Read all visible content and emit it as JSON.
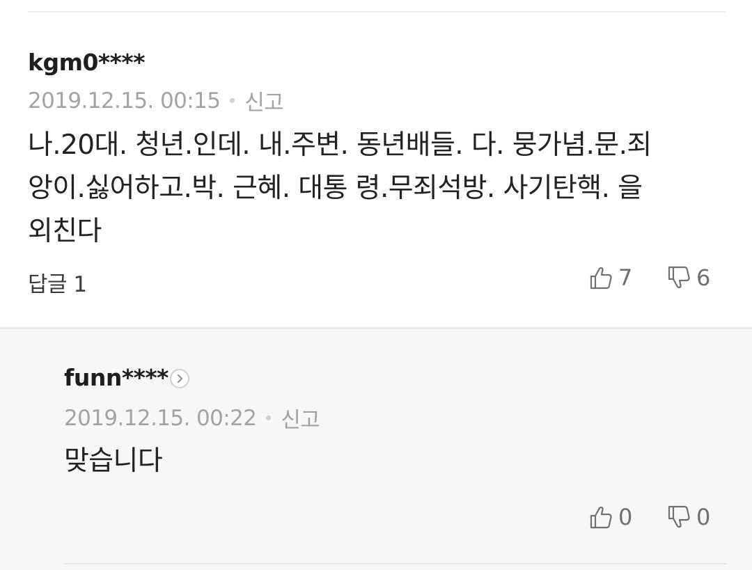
{
  "main_comment": {
    "username": "kgm0****",
    "timestamp": "2019.12.15. 00:15",
    "report_label": "신고",
    "lines": [
      "나.20대. 청년.인데. 내.주변. 동년배들. 다. 뭉가념.문.죄",
      "앙이.싫어하고.박. 근혜. 대통 령.무죄석방. 사기탄핵. 을",
      "외친다"
    ],
    "reply_label": "답글 1",
    "likes": "7",
    "dislikes": "6"
  },
  "reply_comment": {
    "username": "funn****",
    "timestamp": "2019.12.15. 00:22",
    "report_label": "신고",
    "text": "맞습니다",
    "likes": "0",
    "dislikes": "0"
  },
  "icons": {
    "like": "thumbs-up-icon",
    "dislike": "thumbs-down-icon",
    "profile": "chevron-right-icon"
  },
  "colors": {
    "reply_background": "#f7f7f7",
    "meta_text": "#a3a3a3",
    "body_text": "#222222"
  }
}
